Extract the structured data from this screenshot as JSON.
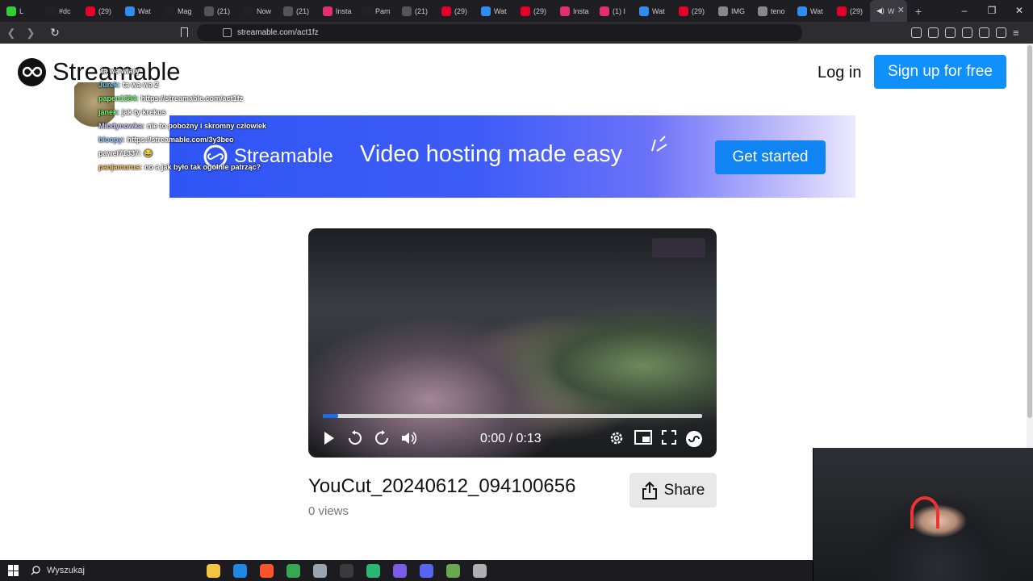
{
  "browser": {
    "tabs": [
      {
        "label": "L",
        "color": "#2fd02f"
      },
      {
        "label": "#dc",
        "color": "#222"
      },
      {
        "label": "(29)",
        "color": "#e4002b"
      },
      {
        "label": "Wat",
        "color": "#2f8df0"
      },
      {
        "label": "Mag",
        "color": "#222"
      },
      {
        "label": "(21)",
        "color": "#555"
      },
      {
        "label": "Now",
        "color": "#222"
      },
      {
        "label": "(21)",
        "color": "#555"
      },
      {
        "label": "Insta",
        "color": "#e1306c"
      },
      {
        "label": "Pam",
        "color": "#222"
      },
      {
        "label": "(21)",
        "color": "#555"
      },
      {
        "label": "(29)",
        "color": "#e4002b"
      },
      {
        "label": "Wat",
        "color": "#2f8df0"
      },
      {
        "label": "(29)",
        "color": "#e4002b"
      },
      {
        "label": "Insta",
        "color": "#e1306c"
      },
      {
        "label": "(1) I",
        "color": "#e1306c"
      },
      {
        "label": "Wat",
        "color": "#2f8df0"
      },
      {
        "label": "(29)",
        "color": "#e4002b"
      },
      {
        "label": "IMG",
        "color": "#888"
      },
      {
        "label": "teno",
        "color": "#888"
      },
      {
        "label": "Wat",
        "color": "#2f8df0"
      },
      {
        "label": "(29)",
        "color": "#e4002b"
      }
    ],
    "active_tab": {
      "label": "W",
      "icon": "speaker-icon"
    },
    "new_tab": "+",
    "window_controls": [
      "–",
      "❐",
      "✕"
    ],
    "nav": {
      "back": "❮",
      "forward": "❯",
      "reload": "↻"
    },
    "url": "streamable.com/act1fz"
  },
  "header": {
    "logo_text": "Streamable",
    "login": "Log in",
    "signup": "Sign up for free"
  },
  "banner": {
    "logo_text": "Streamable",
    "tagline": "Video hosting made easy",
    "cta": "Get started"
  },
  "chat_overlay": [
    {
      "user": "",
      "text": "ta wa wiary",
      "color": "#fff"
    },
    {
      "user": "Jurek:",
      "text": "ta wa wa 2",
      "color": "#6cf"
    },
    {
      "user": "papen1384:",
      "text": "https://streamable.com/act1fz",
      "color": "#7f7"
    },
    {
      "user": "janek:",
      "text": "jak ty krekus",
      "color": "#7f7"
    },
    {
      "user": "Miodynowka:",
      "text": "nie to pobożny i skromny człowiek",
      "color": "#ccf"
    },
    {
      "user": "bloopy:",
      "text": "https://streamable.com/3y3beo",
      "color": "#9cf"
    },
    {
      "user": "pawel71337:",
      "text": "😂",
      "color": "#fff"
    },
    {
      "user": "panjamurus:",
      "text": "no a jak było tak ogólnie patrząc?",
      "color": "#fc6"
    }
  ],
  "video": {
    "progress": 0.04,
    "current_time": "0:00",
    "total_time": "0:13",
    "time_display": "0:00 / 0:13",
    "title": "YouCut_20240612_094100656",
    "views": "0 views",
    "share": "Share"
  },
  "taskbar": {
    "search_label": "Wyszukaj",
    "apps": [
      "#f5c542",
      "#1e88e5",
      "#fb542b",
      "#34a853",
      "#9aa5b1",
      "#3a3a3a",
      "#2bb673",
      "#7d5be6",
      "#5865f2",
      "#6aa84f",
      "#b0b0b0"
    ]
  }
}
